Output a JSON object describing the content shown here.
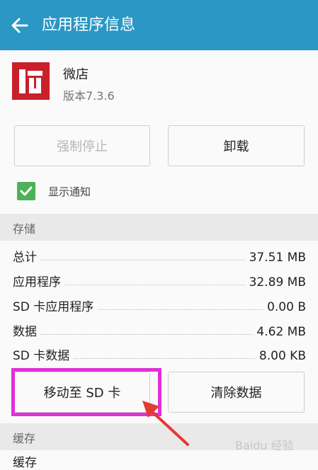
{
  "appbar": {
    "title": "应用程序信息"
  },
  "app": {
    "name": "微店",
    "version": "版本7.3.6"
  },
  "actions": {
    "force_stop": "强制停止",
    "uninstall": "卸载"
  },
  "notification": {
    "label": "显示通知",
    "checked": true
  },
  "storage": {
    "header": "存储",
    "rows": [
      {
        "label": "总计",
        "value": "37.51 MB"
      },
      {
        "label": "应用程序",
        "value": "32.89 MB"
      },
      {
        "label": "SD 卡应用程序",
        "value": "0.00 B"
      },
      {
        "label": "数据",
        "value": "4.62 MB"
      },
      {
        "label": "SD 卡数据",
        "value": "8.00 KB"
      }
    ],
    "move_button": "移动至 SD 卡",
    "clear_button": "清除数据"
  },
  "cache": {
    "header": "缓存",
    "row_label": "缓存"
  },
  "watermark": "Baidu 经验",
  "colors": {
    "appbar": "#2b97c4",
    "highlight": "#e030d8",
    "arrow": "#e53935",
    "checkbox": "#4fb05a",
    "logo": "#c9202a"
  }
}
